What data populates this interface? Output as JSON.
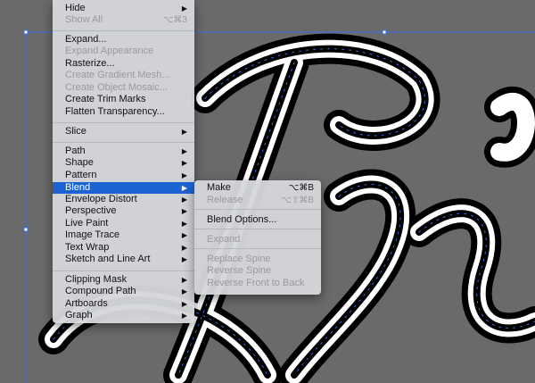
{
  "main_menu": {
    "items": [
      {
        "label": "Hide",
        "submenu": true,
        "enabled": true
      },
      {
        "label": "Show All",
        "shortcut": "⌥⌘3",
        "enabled": false
      },
      {
        "label": "Expand...",
        "enabled": true
      },
      {
        "label": "Expand Appearance",
        "enabled": false
      },
      {
        "label": "Rasterize...",
        "enabled": true
      },
      {
        "label": "Create Gradient Mesh...",
        "enabled": false
      },
      {
        "label": "Create Object Mosaic...",
        "enabled": false
      },
      {
        "label": "Create Trim Marks",
        "enabled": true
      },
      {
        "label": "Flatten Transparency...",
        "enabled": true
      },
      {
        "label": "Slice",
        "submenu": true,
        "enabled": true
      },
      {
        "label": "Path",
        "submenu": true,
        "enabled": true
      },
      {
        "label": "Shape",
        "submenu": true,
        "enabled": true
      },
      {
        "label": "Pattern",
        "submenu": true,
        "enabled": true
      },
      {
        "label": "Blend",
        "submenu": true,
        "enabled": true,
        "highlighted": true
      },
      {
        "label": "Envelope Distort",
        "submenu": true,
        "enabled": true
      },
      {
        "label": "Perspective",
        "submenu": true,
        "enabled": true
      },
      {
        "label": "Live Paint",
        "submenu": true,
        "enabled": true
      },
      {
        "label": "Image Trace",
        "submenu": true,
        "enabled": true
      },
      {
        "label": "Text Wrap",
        "submenu": true,
        "enabled": true
      },
      {
        "label": "Sketch and Line Art",
        "submenu": true,
        "enabled": true
      },
      {
        "label": "Clipping Mask",
        "submenu": true,
        "enabled": true
      },
      {
        "label": "Compound Path",
        "submenu": true,
        "enabled": true
      },
      {
        "label": "Artboards",
        "submenu": true,
        "enabled": true
      },
      {
        "label": "Graph",
        "submenu": true,
        "enabled": true
      }
    ]
  },
  "blend_submenu": {
    "items": [
      {
        "label": "Make",
        "shortcut": "⌥⌘B",
        "enabled": true
      },
      {
        "label": "Release",
        "shortcut": "⌥⇧⌘B",
        "enabled": false
      },
      {
        "label": "Blend Options...",
        "enabled": true
      },
      {
        "label": "Expand",
        "enabled": false
      },
      {
        "label": "Replace Spine",
        "enabled": false
      },
      {
        "label": "Reverse Spine",
        "enabled": false
      },
      {
        "label": "Reverse Front to Back",
        "enabled": false
      }
    ]
  },
  "colors": {
    "highlight": "#1c63d2",
    "selection": "#3a6cf0",
    "canvas": "#6a6a6a"
  }
}
